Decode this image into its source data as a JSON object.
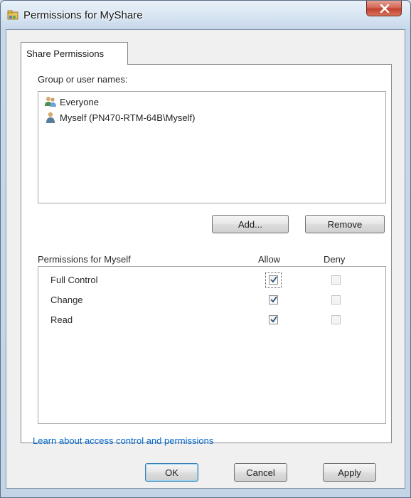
{
  "window": {
    "title": "Permissions for MyShare",
    "close_symbol": "X",
    "title_icon": "folder-share-icon",
    "close_icon": "close-icon"
  },
  "tabs": [
    {
      "label": "Share Permissions"
    }
  ],
  "users_section": {
    "label": "Group or user names:",
    "users": [
      {
        "name": "Everyone",
        "icon": "group-users-icon"
      },
      {
        "name": "Myself (PN470-RTM-64B\\Myself)",
        "icon": "user-icon"
      }
    ],
    "add_button": "Add...",
    "remove_button": "Remove"
  },
  "permissions": {
    "header": "Permissions for Myself",
    "allow_header": "Allow",
    "deny_header": "Deny",
    "rows": [
      {
        "name": "Full Control",
        "allow": true,
        "deny": false
      },
      {
        "name": "Change",
        "allow": true,
        "deny": false
      },
      {
        "name": "Read",
        "allow": true,
        "deny": false
      }
    ]
  },
  "link_text": "Learn about access control and permissions",
  "buttons": {
    "ok": "OK",
    "cancel": "Cancel",
    "apply": "Apply"
  },
  "colors": {
    "link": "#0066cc",
    "close_button": "#c2402c",
    "window_frame": "#c3d4e7"
  }
}
